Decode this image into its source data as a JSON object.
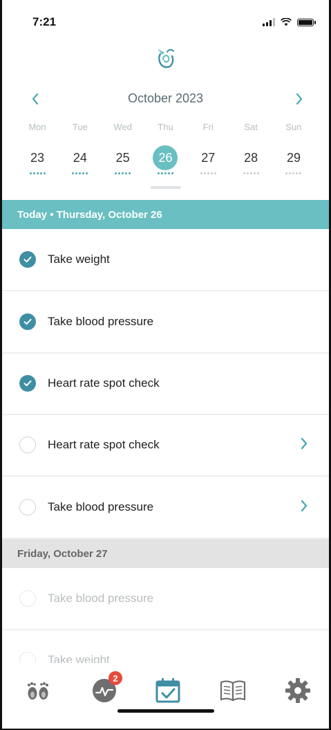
{
  "status_bar": {
    "time": "7:21"
  },
  "calendar": {
    "month_label": "October 2023",
    "days": [
      {
        "name": "Mon",
        "num": "23",
        "selected": false,
        "dots": "full"
      },
      {
        "name": "Tue",
        "num": "24",
        "selected": false,
        "dots": "full"
      },
      {
        "name": "Wed",
        "num": "25",
        "selected": false,
        "dots": "full"
      },
      {
        "name": "Thu",
        "num": "26",
        "selected": true,
        "dots": "full"
      },
      {
        "name": "Fri",
        "num": "27",
        "selected": false,
        "dots": "muted"
      },
      {
        "name": "Sat",
        "num": "28",
        "selected": false,
        "dots": "muted"
      },
      {
        "name": "Sun",
        "num": "29",
        "selected": false,
        "dots": "muted"
      }
    ]
  },
  "today_section": {
    "header": "Today • Thursday, October 26",
    "tasks": [
      {
        "label": "Take weight",
        "done": true
      },
      {
        "label": "Take blood pressure",
        "done": true
      },
      {
        "label": "Heart rate spot check",
        "done": true
      },
      {
        "label": "Heart rate spot check",
        "done": false
      },
      {
        "label": "Take blood pressure",
        "done": false
      }
    ]
  },
  "friday_section": {
    "header": "Friday, October 27",
    "tasks": [
      {
        "label": "Take blood pressure",
        "done": false
      },
      {
        "label": "Take weight",
        "done": false
      }
    ]
  },
  "tab_bar": {
    "tabs": [
      {
        "icon": "feet-icon"
      },
      {
        "icon": "activity-icon",
        "badge": "2"
      },
      {
        "icon": "calendar-check-icon"
      },
      {
        "icon": "book-icon"
      },
      {
        "icon": "gear-icon"
      }
    ]
  },
  "colors": {
    "accent": "#69bfc2",
    "accent_dark": "#3f8ea4",
    "badge": "#e84a3c"
  }
}
